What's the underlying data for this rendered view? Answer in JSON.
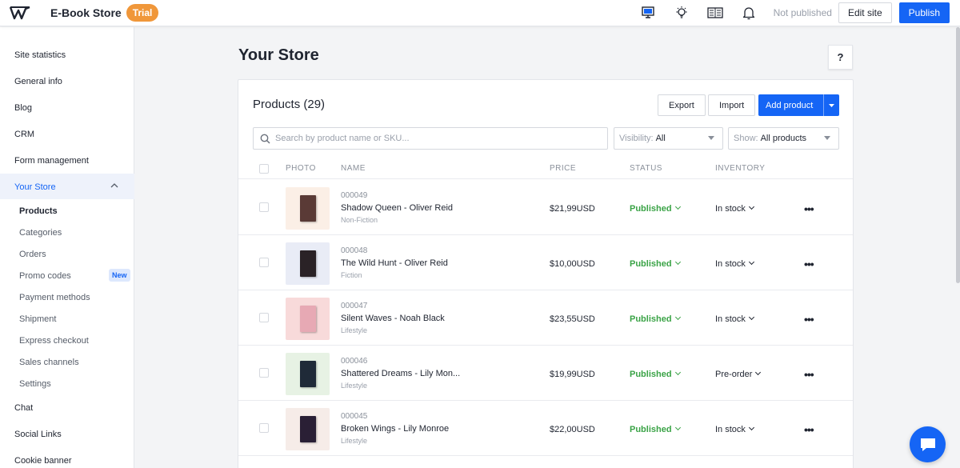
{
  "header": {
    "site_name": "E-Book Store",
    "trial_badge": "Trial",
    "publish_state": "Not published",
    "edit_label": "Edit site",
    "publish_label": "Publish"
  },
  "sidebar": {
    "items": [
      "Site statistics",
      "General info",
      "Blog",
      "CRM",
      "Form management"
    ],
    "active": "Your Store",
    "sub_items": [
      "Products",
      "Categories",
      "Orders",
      "Promo codes",
      "Payment methods",
      "Shipment",
      "Express checkout",
      "Sales channels",
      "Settings"
    ],
    "new_badge": "New",
    "bottom_items": [
      "Chat",
      "Social Links",
      "Cookie banner"
    ]
  },
  "page": {
    "title": "Your Store",
    "help": "?"
  },
  "products": {
    "title": "Products (29)",
    "export_label": "Export",
    "import_label": "Import",
    "add_label": "Add product",
    "search_placeholder": "Search by product name or SKU...",
    "visibility_key": "Visibility:",
    "visibility_value": "All",
    "show_key": "Show:",
    "show_value": "All products",
    "columns": [
      "PHOTO",
      "NAME",
      "PRICE",
      "STATUS",
      "INVENTORY"
    ],
    "rows": [
      {
        "sku": "000049",
        "name": "Shadow Queen - Oliver Reid",
        "category": "Non-Fiction",
        "price": "$21,99USD",
        "status": "Published",
        "inventory": "In stock",
        "thumb_bg": "#fbefe6",
        "book_color": "#5a3a36"
      },
      {
        "sku": "000048",
        "name": "The Wild Hunt - Oliver Reid",
        "category": "Fiction",
        "price": "$10,00USD",
        "status": "Published",
        "inventory": "In stock",
        "thumb_bg": "#e9ecf6",
        "book_color": "#2a2226"
      },
      {
        "sku": "000047",
        "name": "Silent Waves - Noah Black",
        "category": "Lifestyle",
        "price": "$23,55USD",
        "status": "Published",
        "inventory": "In stock",
        "thumb_bg": "#f8dada",
        "book_color": "#e7a9b4"
      },
      {
        "sku": "000046",
        "name": "Shattered Dreams - Lily Mon...",
        "category": "Lifestyle",
        "price": "$19,99USD",
        "status": "Published",
        "inventory": "Pre-order",
        "thumb_bg": "#e7f2e4",
        "book_color": "#1f2a38"
      },
      {
        "sku": "000045",
        "name": "Broken Wings - Lily Monroe",
        "category": "Lifestyle",
        "price": "$22,00USD",
        "status": "Published",
        "inventory": "In stock",
        "thumb_bg": "#f6ece8",
        "book_color": "#2a1f35"
      }
    ]
  },
  "colors": {
    "accent": "#1565f5",
    "trial": "#f0973a",
    "published": "#3aa346"
  }
}
